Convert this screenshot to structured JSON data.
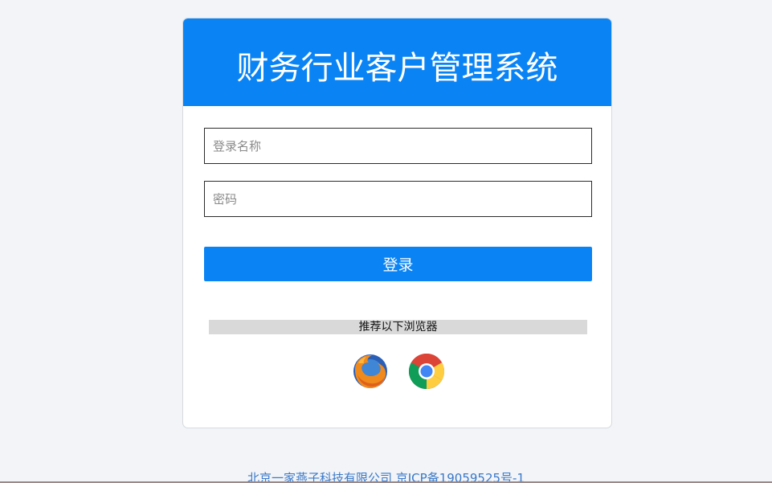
{
  "header": {
    "title": "财务行业客户管理系统"
  },
  "form": {
    "username_placeholder": "登录名称",
    "username_value": "",
    "password_placeholder": "密码",
    "password_value": "",
    "login_label": "登录"
  },
  "browsers": {
    "recommend_label": "推荐以下浏览器",
    "icons": [
      "firefox-icon",
      "chrome-icon"
    ]
  },
  "footer": {
    "text": "北京一家燕子科技有限公司 京ICP备19059525号-1"
  },
  "colors": {
    "accent": "#0a84f5",
    "background": "#f2f4f7",
    "footer_link": "#3a78c9"
  }
}
